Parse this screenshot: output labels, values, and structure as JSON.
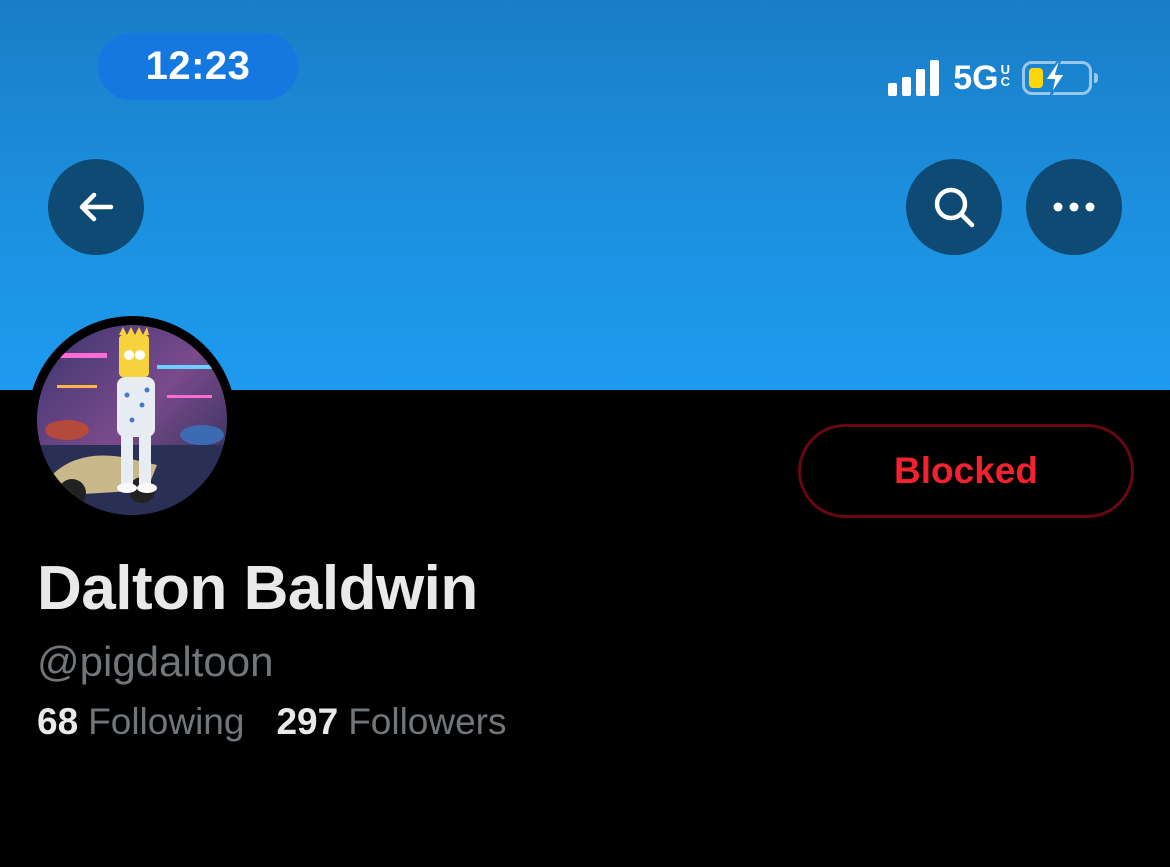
{
  "status_bar": {
    "time": "12:23",
    "network": "5G",
    "network_suffix_top": "U",
    "network_suffix_bottom": "C",
    "battery_color": "#ffd60a",
    "charging": true
  },
  "header": {
    "back_icon": "arrow-left-icon",
    "search_icon": "search-icon",
    "more_icon": "ellipsis-icon",
    "banner_color": "#1d9bf0"
  },
  "profile": {
    "avatar_icon": "profile-avatar",
    "display_name": "Dalton Baldwin",
    "handle": "@pigdaltoon",
    "blocked_label": "Blocked",
    "following_count": "68",
    "following_label": "Following",
    "followers_count": "297",
    "followers_label": "Followers",
    "accent_danger": "#f4212e"
  }
}
